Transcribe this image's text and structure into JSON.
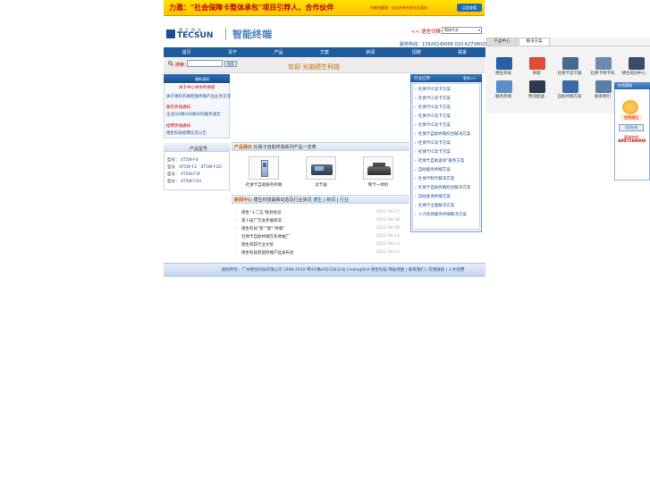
{
  "banner": {
    "headline": "力邀：\"社会保障卡整体承包\"项目引荐人，合作伙伴",
    "subline": "先确名额限 · 佳佳名单开始大全面伙",
    "button": "点此查看"
  },
  "header": {
    "logo_cn": "德生科技",
    "logo_en": "TECSUN",
    "tagline": "智能终端",
    "lang_label": "<< 语言切换：",
    "lang_value": "简体中文",
    "hotline": "服务热线：13926249008  020-62738028"
  },
  "nav": [
    "首页",
    "关于",
    "产品",
    "方案",
    "新闻",
    "招聘",
    "联系"
  ],
  "search": {
    "label": "搜索：",
    "placeholder": "",
    "button": "搜索"
  },
  "welcome": "欢迎    光临德生科技",
  "sidebar_top": {
    "title": "最新通知",
    "items": [
      "关于中心举办的讲座",
      "关于组织开展智能终端产品业务交流",
      "服务热线通知",
      "企业QQ群/QQ群号码服务通告",
      "招聘热线通知",
      "德生科技招聘信息公告"
    ]
  },
  "sidebar_bottom": {
    "title": "产品型号",
    "rows": [
      {
        "label": "型号：",
        "values": [
          "4T5W-F4"
        ]
      },
      {
        "label": "型号",
        "values": [
          "4T5W-F2",
          "4T5W-F2D"
        ]
      },
      {
        "label": "型号：",
        "values": [
          "4T5W-F3F"
        ]
      },
      {
        "label": "型号：",
        "values": [
          "4T5W-F2H"
        ]
      }
    ]
  },
  "products": {
    "title_lead": "产品展示",
    "title_rest": "社保卡自助终端系列产品一览表",
    "items": [
      {
        "caption": "社保卡自助服务终端"
      },
      {
        "caption": "读卡器"
      },
      {
        "caption": "制卡一体机"
      }
    ]
  },
  "news": {
    "title_lead": "新闻中心",
    "title_rest": "德生科技最新动态及行业资讯",
    "links": [
      "德生",
      "新闻",
      "行业"
    ],
    "items": [
      {
        "text": "德生\"十二五\"规划会议",
        "date": "2011-04-27"
      },
      {
        "text": "第十届广交会参展情况",
        "date": "2011-04-26"
      },
      {
        "text": "德生科技\"智\"\"能\"\"终端\"",
        "date": "2011-04-20"
      },
      {
        "text": "社保卡自助终端在各地推广",
        "date": "2011-04-14"
      },
      {
        "text": "德生荣获行业大奖",
        "date": "2011-04-13"
      },
      {
        "text": "德生科技智能终端产品发布会",
        "date": "2011-04-13"
      }
    ]
  },
  "right_list": {
    "title": "行业应用",
    "more": "更多>>",
    "items": [
      "社保卡IC读卡方案",
      "社保卡IC读卡方案",
      "社保卡IC读卡方案",
      "社保卡IC读卡方案",
      "社保卡IC读卡方案",
      "社保卡自助终端综合解决方案",
      "社保卡IC读卡方案",
      "社保卡IC读卡方案",
      "社保卡自助查询\"服务方案",
      "自助服务终端方案",
      "社保卡制卡解决方案",
      "社保卡自助终端综合解决方案",
      "自助查询终端方案",
      "社保卡全面解决方案",
      "人力资源服务终端解决方案"
    ]
  },
  "footer": "版权所有：广州德生科技有限公司 1998-2010 粤ICP备05015831号 LindingStat 德生科技 网站地图 | 联系我们 | 友情链接 | 人才招聘",
  "right_panel": {
    "tabs": [
      "产品中心",
      "解决方案"
    ],
    "icons": [
      {
        "name": "tecsun-logo-icon",
        "label": "德生科技",
        "color": "#2a5fa5"
      },
      {
        "name": "mall-icon",
        "label": "商城",
        "color": "#e04a3a"
      },
      {
        "name": "card-reader-icon",
        "label": "社保卡读卡器",
        "color": "#4a6a8c"
      },
      {
        "name": "terminal-icon",
        "label": "社保卡制卡机",
        "color": "#6b8bb0"
      },
      {
        "name": "graduation-icon",
        "label": "德生培训中心",
        "color": "#3a4c66"
      },
      {
        "name": "monitor-icon",
        "label": "服务热线",
        "color": "#5a8fc8"
      },
      {
        "name": "car-icon",
        "label": "物流配送",
        "color": "#2e3a4f"
      },
      {
        "name": "laptop-icon",
        "label": "自助终端方案",
        "color": "#3c6aa5"
      },
      {
        "name": "person-icon",
        "label": "联系我们",
        "color": "#5a7ea5"
      }
    ]
  },
  "service": {
    "title": "在线客服",
    "free": "免费通话",
    "qq": "QQ在线",
    "label": "客服热线：",
    "phone": "4007169008"
  }
}
